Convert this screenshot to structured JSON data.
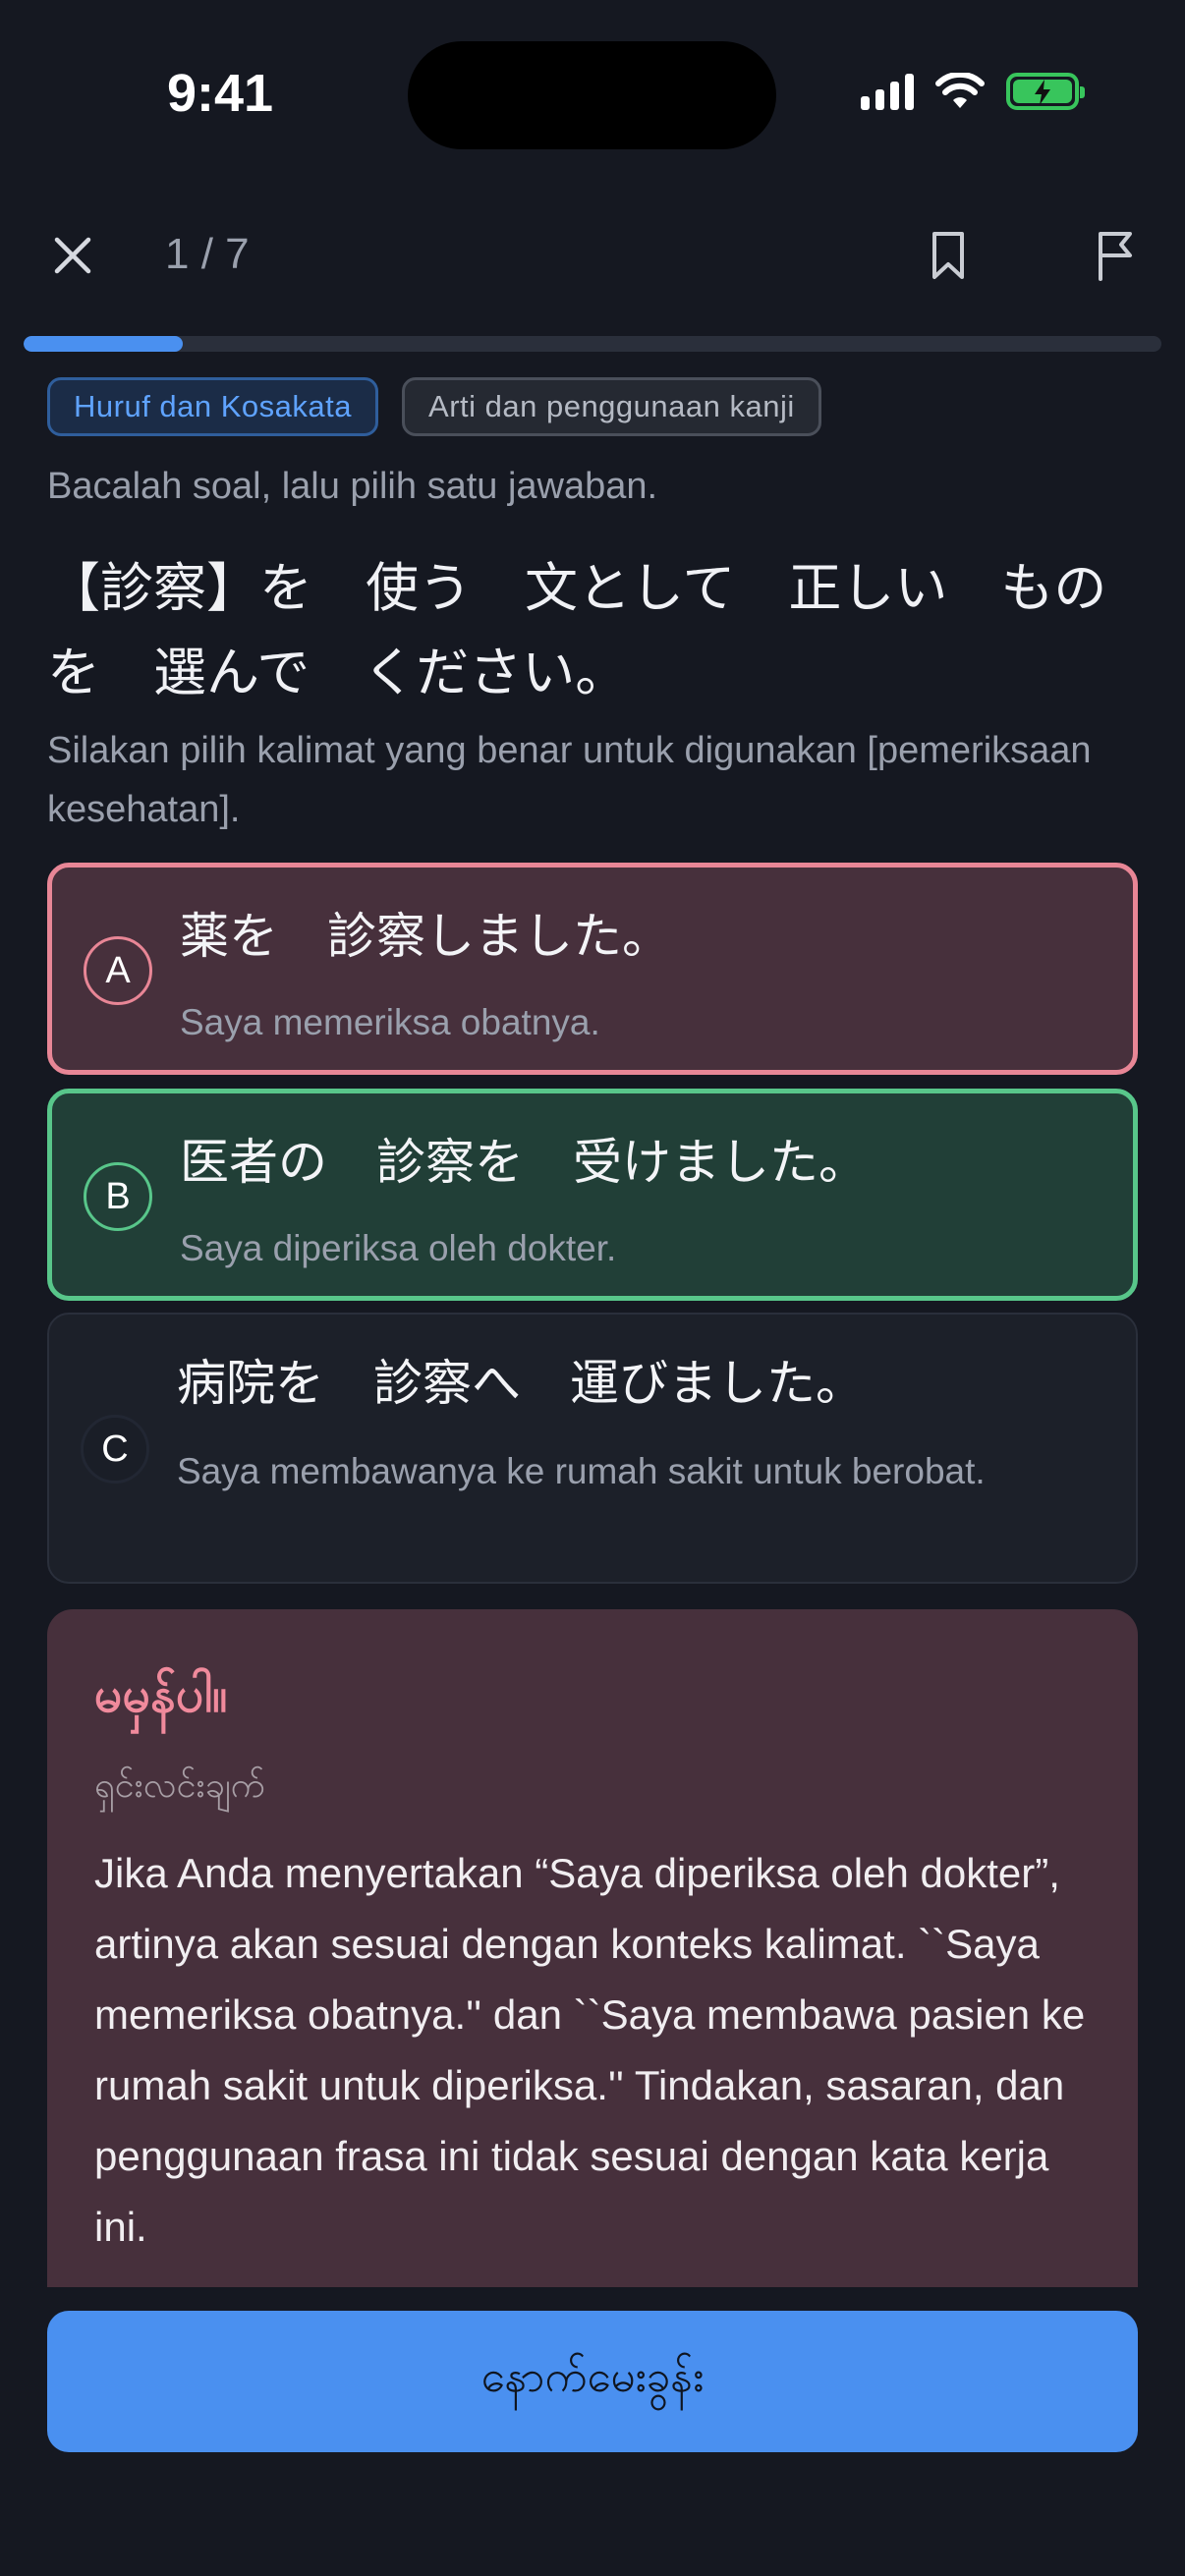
{
  "status_bar": {
    "time": "9:41"
  },
  "header": {
    "counter": "1 / 7",
    "progress": 0.14
  },
  "tags": [
    "Huruf dan Kosakata",
    "Arti dan penggunaan kanji"
  ],
  "instruction": "Bacalah soal, lalu pilih satu jawaban.",
  "question": {
    "text": "【診察】を　使う　文として　正しい　ものを　選んで　ください。",
    "translation": "Silakan pilih kalimat yang benar untuk digunakan [pemeriksaan kesehatan]."
  },
  "options": [
    {
      "letter": "A",
      "text": "薬を　診察しました。",
      "translation": "Saya memeriksa obatnya.",
      "state": "wrong"
    },
    {
      "letter": "B",
      "text": "医者の　診察を　受けました。",
      "translation": "Saya diperiksa oleh dokter.",
      "state": "correct"
    },
    {
      "letter": "C",
      "text": "病院を　診察へ　運びました。",
      "translation": "Saya membawanya ke rumah sakit untuk berobat.",
      "state": "neutral"
    }
  ],
  "explanation": {
    "title": "မမှန်ပါ။",
    "subtitle": "ရှင်းလင်းချက်",
    "body": "Jika Anda menyertakan “Saya diperiksa oleh dokter”, artinya akan sesuai dengan konteks kalimat. ``Saya memeriksa obatnya.'' dan ``Saya membawa pasien ke rumah sakit untuk diperiksa.'' Tindakan, sasaran, dan penggunaan frasa ini tidak sesuai dengan kata kerja ini."
  },
  "next_button": "နောက်မေးခွန်း",
  "colors": {
    "accent": "#4a90f0",
    "wrong": "#e88696",
    "correct": "#58c68a",
    "background": "#151821"
  }
}
